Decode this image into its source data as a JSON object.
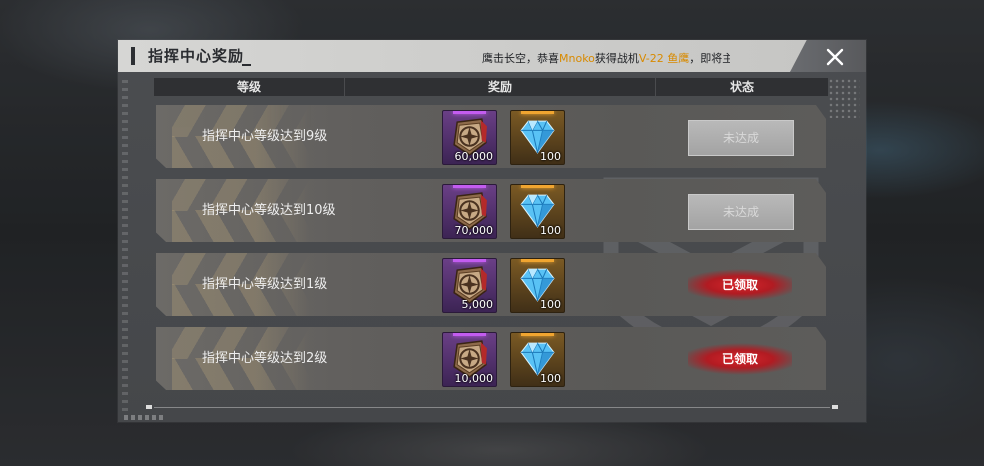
{
  "window": {
    "title": "指挥中心奖励",
    "ticker": {
      "prefix": "鹰击长空，恭喜",
      "player": "Mnoko",
      "middle": "获得战机",
      "reward": "V-22 鱼鹰",
      "suffix": "，即将主宰"
    }
  },
  "headers": {
    "level": "等级",
    "reward": "奖励",
    "status": "状态"
  },
  "rows": [
    {
      "label": "指挥中心等级达到9级",
      "medal_qty": "60,000",
      "diamond_qty": "100",
      "status": "未达成",
      "state": "pending"
    },
    {
      "label": "指挥中心等级达到10级",
      "medal_qty": "70,000",
      "diamond_qty": "100",
      "status": "未达成",
      "state": "pending"
    },
    {
      "label": "指挥中心等级达到1级",
      "medal_qty": "5,000",
      "diamond_qty": "100",
      "status": "已领取",
      "state": "claimed"
    },
    {
      "label": "指挥中心等级达到2级",
      "medal_qty": "10,000",
      "diamond_qty": "100",
      "status": "已领取",
      "state": "claimed"
    }
  ],
  "icons": {
    "close": "close-icon",
    "medal": "medal-badge-icon",
    "diamond": "diamond-icon"
  },
  "colors": {
    "highlight": "#d88a00",
    "claimed_red": "#d7262c",
    "purple_rarity": "#c35cf0",
    "gold_rarity": "#f0a530"
  }
}
